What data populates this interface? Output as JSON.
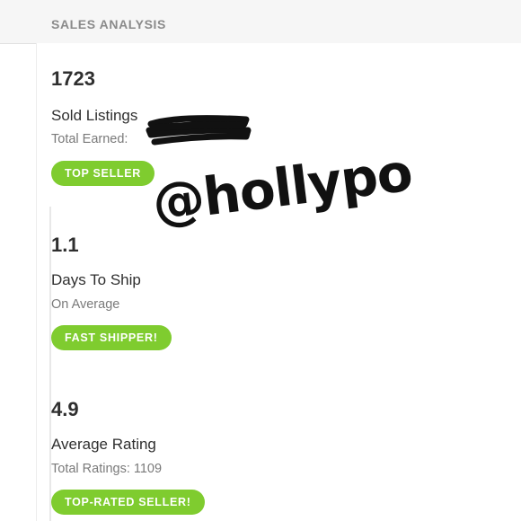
{
  "header": {
    "title": "SALES ANALYSIS"
  },
  "stats": [
    {
      "value": "1723",
      "title": "Sold Listings",
      "subtitle": "Total Earned:",
      "badge": "TOP SELLER"
    },
    {
      "value": "1.1",
      "title": "Days To Ship",
      "subtitle": "On Average",
      "badge": "FAST SHIPPER!"
    },
    {
      "value": "4.9",
      "title": "Average Rating",
      "subtitle": "Total Ratings: 1109",
      "badge": "TOP-RATED SELLER!"
    }
  ],
  "overlay": {
    "watermark": "@hollypo"
  },
  "colors": {
    "badge": "#7fcc2f",
    "header_background": "#f6f6f6",
    "header_text": "#8a8a8a",
    "primary_text": "#2f2f2f",
    "secondary_text": "#7a7a7a"
  }
}
